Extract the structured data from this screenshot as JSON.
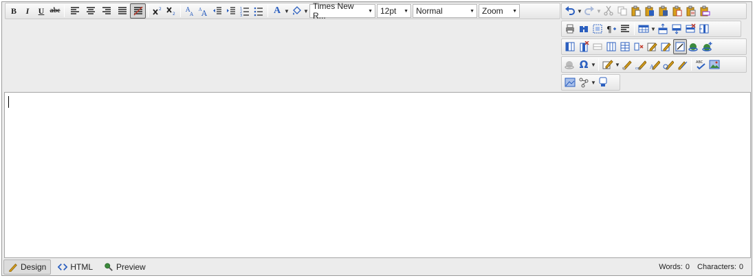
{
  "toolbar": {
    "bold": "B",
    "italic": "I",
    "underline": "U",
    "strike": "abc",
    "font_name": "Times New R...",
    "font_size": "12pt",
    "paragraph": "Normal",
    "zoom": "Zoom",
    "font_color": "A",
    "omega": "Ω"
  },
  "modes": {
    "design": "Design",
    "html": "HTML",
    "preview": "Preview"
  },
  "status": {
    "words_label": "Words:",
    "words": "0",
    "chars_label": "Characters:",
    "chars": "0"
  },
  "colors": {
    "accent_blue": "#2b5fbf",
    "icon_gold": "#d9a01c",
    "icon_green": "#3c8a3c"
  }
}
